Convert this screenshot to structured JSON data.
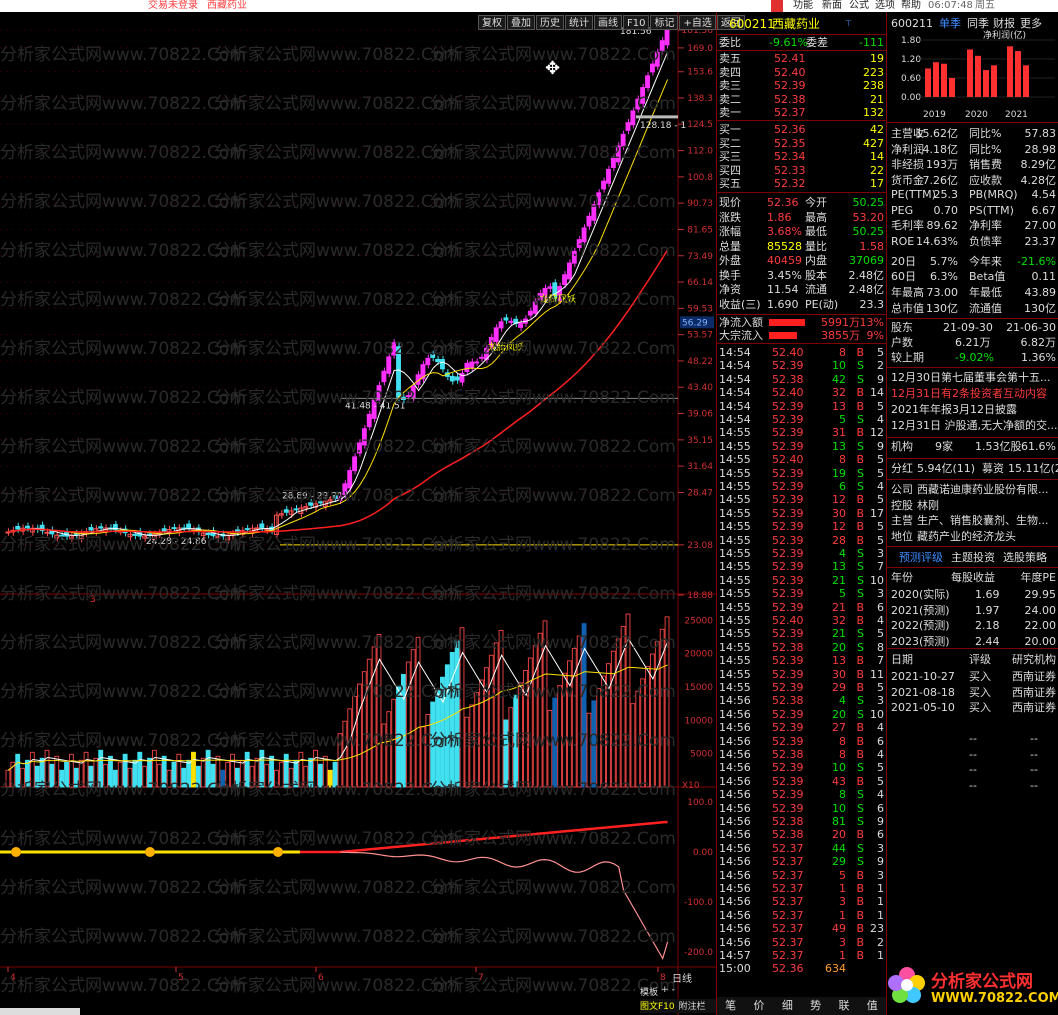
{
  "topbar": {
    "trade_status": "交易未登录",
    "stock": "西藏药业",
    "menus": [
      "功能",
      "新面",
      "公式",
      "选项",
      "帮助"
    ],
    "time": "06:07:48",
    "right": [
      "周五"
    ]
  },
  "toolbar": [
    "复权",
    "叠加",
    "历史",
    "统计",
    "画线",
    "F10",
    "标记",
    "+自选",
    "返回"
  ],
  "chart": {
    "price_ticks": [
      "181.56",
      "169.0",
      "153.6",
      "138.3",
      "124.5",
      "112.0",
      "100.8",
      "90.73",
      "81.65",
      "73.49",
      "66.14",
      "59.53",
      "53.57",
      "48.22",
      "43.40",
      "39.06",
      "35.15",
      "31.64",
      "28.47",
      "23.08",
      "18.88"
    ],
    "current_tag": "56.29",
    "annotations": {
      "high": "181.56",
      "a1": "128.18 - 1",
      "a2": "41.48 - 41.51",
      "a3": "28.89 - 29.90",
      "a4": "24.28 - 24.86",
      "c1": "龙腾凤妖",
      "c2": "龙腾凤妖",
      "mark3": "3"
    },
    "vol_ticks": [
      "25000",
      "20000",
      "15000",
      "10000",
      "5000",
      "X10"
    ],
    "ind_ticks": [
      "100.0",
      "0.00",
      "-100.0",
      "-200.0"
    ],
    "x_labels": [
      "4",
      "5",
      "6",
      "7",
      "8"
    ],
    "period": "日线",
    "bottom_buttons": [
      "模板",
      "+",
      "-"
    ],
    "bottom_tabs": [
      "图文F10",
      "附注栏"
    ]
  },
  "quote": {
    "code": "600211",
    "name": "西藏药业",
    "weibi": {
      "label": "委比",
      "value": "-9.61%",
      "cha_label": "委差",
      "cha": "-111"
    },
    "sells": [
      [
        "卖五",
        "52.41",
        "19"
      ],
      [
        "卖四",
        "52.40",
        "223"
      ],
      [
        "卖三",
        "52.39",
        "238"
      ],
      [
        "卖二",
        "52.38",
        "21"
      ],
      [
        "卖一",
        "52.37",
        "132"
      ]
    ],
    "buys": [
      [
        "买一",
        "52.36",
        "42"
      ],
      [
        "买二",
        "52.35",
        "427"
      ],
      [
        "买三",
        "52.34",
        "14"
      ],
      [
        "买四",
        "52.33",
        "22"
      ],
      [
        "买五",
        "52.32",
        "17"
      ]
    ],
    "stats": [
      [
        "现价",
        "52.36",
        "今开",
        "50.25"
      ],
      [
        "涨跌",
        "1.86",
        "最高",
        "53.20"
      ],
      [
        "涨幅",
        "3.68%",
        "最低",
        "50.25"
      ],
      [
        "总量",
        "85528",
        "量比",
        "1.58"
      ],
      [
        "外盘",
        "40459",
        "内盘",
        "37069"
      ],
      [
        "换手",
        "3.45%",
        "股本",
        "2.48亿"
      ],
      [
        "净资",
        "11.54",
        "流通",
        "2.48亿"
      ],
      [
        "收益(三)",
        "1.690",
        "PE(动)",
        "23.3"
      ]
    ],
    "flows": [
      [
        "净流入额",
        "5991万",
        "13%"
      ],
      [
        "大宗流入",
        "3855万",
        "9%"
      ]
    ],
    "ticks": [
      [
        "14:54",
        "52.40",
        "8",
        "B",
        "5"
      ],
      [
        "14:54",
        "52.39",
        "10",
        "S",
        "2"
      ],
      [
        "14:54",
        "52.38",
        "42",
        "S",
        "9"
      ],
      [
        "14:54",
        "52.40",
        "32",
        "B",
        "14"
      ],
      [
        "14:54",
        "52.39",
        "13",
        "B",
        "5"
      ],
      [
        "14:54",
        "52.39",
        "5",
        "S",
        "4"
      ],
      [
        "14:55",
        "52.39",
        "31",
        "B",
        "12"
      ],
      [
        "14:55",
        "52.39",
        "13",
        "S",
        "9"
      ],
      [
        "14:55",
        "52.40",
        "8",
        "B",
        "5"
      ],
      [
        "14:55",
        "52.39",
        "19",
        "S",
        "5"
      ],
      [
        "14:55",
        "52.39",
        "6",
        "S",
        "4"
      ],
      [
        "14:55",
        "52.39",
        "12",
        "B",
        "5"
      ],
      [
        "14:55",
        "52.39",
        "30",
        "B",
        "17"
      ],
      [
        "14:55",
        "52.39",
        "12",
        "B",
        "5"
      ],
      [
        "14:55",
        "52.39",
        "28",
        "B",
        "5"
      ],
      [
        "14:55",
        "52.39",
        "4",
        "S",
        "3"
      ],
      [
        "14:55",
        "52.39",
        "13",
        "S",
        "7"
      ],
      [
        "14:55",
        "52.39",
        "21",
        "S",
        "10"
      ],
      [
        "14:55",
        "52.39",
        "5",
        "S",
        "3"
      ],
      [
        "14:55",
        "52.39",
        "21",
        "B",
        "6"
      ],
      [
        "14:55",
        "52.40",
        "32",
        "B",
        "4"
      ],
      [
        "14:55",
        "52.39",
        "21",
        "S",
        "5"
      ],
      [
        "14:55",
        "52.38",
        "20",
        "S",
        "8"
      ],
      [
        "14:55",
        "52.39",
        "13",
        "B",
        "7"
      ],
      [
        "14:55",
        "52.39",
        "30",
        "B",
        "11"
      ],
      [
        "14:55",
        "52.39",
        "29",
        "B",
        "5"
      ],
      [
        "14:56",
        "52.38",
        "4",
        "S",
        "3"
      ],
      [
        "14:56",
        "52.39",
        "20",
        "S",
        "10"
      ],
      [
        "14:56",
        "52.39",
        "27",
        "B",
        "4"
      ],
      [
        "14:56",
        "52.39",
        "8",
        "B",
        "6"
      ],
      [
        "14:56",
        "52.38",
        "8",
        "B",
        "4"
      ],
      [
        "14:56",
        "52.39",
        "10",
        "S",
        "5"
      ],
      [
        "14:56",
        "52.39",
        "43",
        "B",
        "5"
      ],
      [
        "14:56",
        "52.39",
        "8",
        "S",
        "4"
      ],
      [
        "14:56",
        "52.39",
        "10",
        "S",
        "6"
      ],
      [
        "14:56",
        "52.38",
        "81",
        "S",
        "9"
      ],
      [
        "14:56",
        "52.38",
        "20",
        "B",
        "6"
      ],
      [
        "14:56",
        "52.37",
        "44",
        "S",
        "3"
      ],
      [
        "14:56",
        "52.37",
        "29",
        "S",
        "9"
      ],
      [
        "14:56",
        "52.37",
        "5",
        "B",
        "3"
      ],
      [
        "14:56",
        "52.37",
        "1",
        "B",
        "1"
      ],
      [
        "14:56",
        "52.37",
        "3",
        "B",
        "1"
      ],
      [
        "14:56",
        "52.37",
        "1",
        "B",
        "1"
      ],
      [
        "14:56",
        "52.37",
        "49",
        "B",
        "23"
      ],
      [
        "14:56",
        "52.37",
        "3",
        "B",
        "2"
      ],
      [
        "14:57",
        "52.37",
        "1",
        "B",
        "1"
      ],
      [
        "15:00",
        "52.36",
        "634",
        "",
        ""
      ]
    ],
    "bottom_tabs": [
      "笔",
      "价",
      "细",
      "势",
      "联",
      "值"
    ]
  },
  "f10": {
    "code": "600211",
    "tabs": [
      "单季",
      "同季",
      "财报",
      "更多"
    ],
    "chart_title": "净利润(亿)",
    "chart_ticks": [
      "1.80",
      "1.20",
      "0.60",
      "0.00"
    ],
    "chart_years": [
      "2019",
      "2020",
      "2021"
    ],
    "bars": [
      [
        0.9,
        1.1,
        1.05,
        0.6
      ],
      [
        1.5,
        1.3,
        0.85,
        1.0
      ],
      [
        1.6,
        1.45,
        1.0
      ]
    ],
    "fin": [
      [
        "主营收",
        "15.62亿",
        "同比%",
        "57.83"
      ],
      [
        "净利润",
        "4.18亿",
        "同比%",
        "28.98"
      ],
      [
        "非经损",
        "193万",
        "销售费",
        "8.29亿"
      ],
      [
        "货币金",
        "7.26亿",
        "应收款",
        "4.28亿"
      ],
      [
        "PE(TTM)",
        "25.3",
        "PB(MRQ)",
        "4.54"
      ],
      [
        "PEG",
        "0.70",
        "PS(TTM)",
        "6.67"
      ],
      [
        "毛利率",
        "89.62",
        "净利率",
        "27.00"
      ],
      [
        "ROE",
        "14.63%",
        "负债率",
        "23.37"
      ],
      [
        "20日",
        "5.7%",
        "今年来",
        "-21.6%"
      ],
      [
        "60日",
        "6.3%",
        "Beta值",
        "0.11"
      ],
      [
        "年最高",
        "73.00",
        "年最低",
        "43.89"
      ],
      [
        "总市值",
        "130亿",
        "流通值",
        "130亿"
      ]
    ],
    "holders": {
      "label": "股东",
      "d1": "21-09-30",
      "d2": "21-06-30",
      "hushu_label": "户数",
      "v1": "6.21万",
      "v2": "6.82万",
      "change_label": "较上期",
      "c1": "-9.02%",
      "c2": "1.36%"
    },
    "news": [
      {
        "text": "12月30日第七届董事会第十五...",
        "color": "#dddddd"
      },
      {
        "text": "12月31日有2条投资者互动内容",
        "color": "#ff3c3c"
      },
      {
        "text": "2021年年报3月12日披露",
        "color": "#dddddd"
      },
      {
        "text": "12月31日 沪股通,无大净额的交...",
        "color": "#dddddd"
      }
    ],
    "inst": {
      "label": "机构",
      "v": "9家",
      "amt": "1.53亿股",
      "pct": "61.6%"
    },
    "dividend": {
      "label": "分红",
      "v": "5.94亿(11)",
      "label2": "募资",
      "v2": "15.11亿(2)"
    },
    "company": [
      [
        "公司",
        "西藏诺迪康药业股份有限..."
      ],
      [
        "控股",
        "林刚"
      ],
      [
        "主营",
        "生产、销售胶囊剂、生物..."
      ],
      [
        "地位",
        "藏药产业的经济龙头"
      ]
    ],
    "tabs2": [
      "预测评级",
      "主题投资",
      "选股策略"
    ],
    "forecast_header": [
      "年份",
      "每股收益",
      "年度PE"
    ],
    "forecast": [
      [
        "2020(实际)",
        "1.69",
        "29.95"
      ],
      [
        "2021(预测)",
        "1.97",
        "24.00"
      ],
      [
        "2022(预测)",
        "2.18",
        "22.00"
      ],
      [
        "2023(预测)",
        "2.44",
        "20.00"
      ]
    ],
    "rating_header": [
      "日期",
      "评级",
      "研究机构"
    ],
    "ratings": [
      [
        "2021-10-27",
        "买入",
        "西南证券"
      ],
      [
        "2021-08-18",
        "买入",
        "西南证券"
      ],
      [
        "2021-05-10",
        "买入",
        "西南证券"
      ]
    ],
    "dashes": [
      "--",
      "--",
      "--",
      "--"
    ]
  },
  "watermark": {
    "text": "分析家公式网www.70822.Com",
    "logo_title": "分析家公式网",
    "logo_url": "WWW.70822.COM"
  }
}
